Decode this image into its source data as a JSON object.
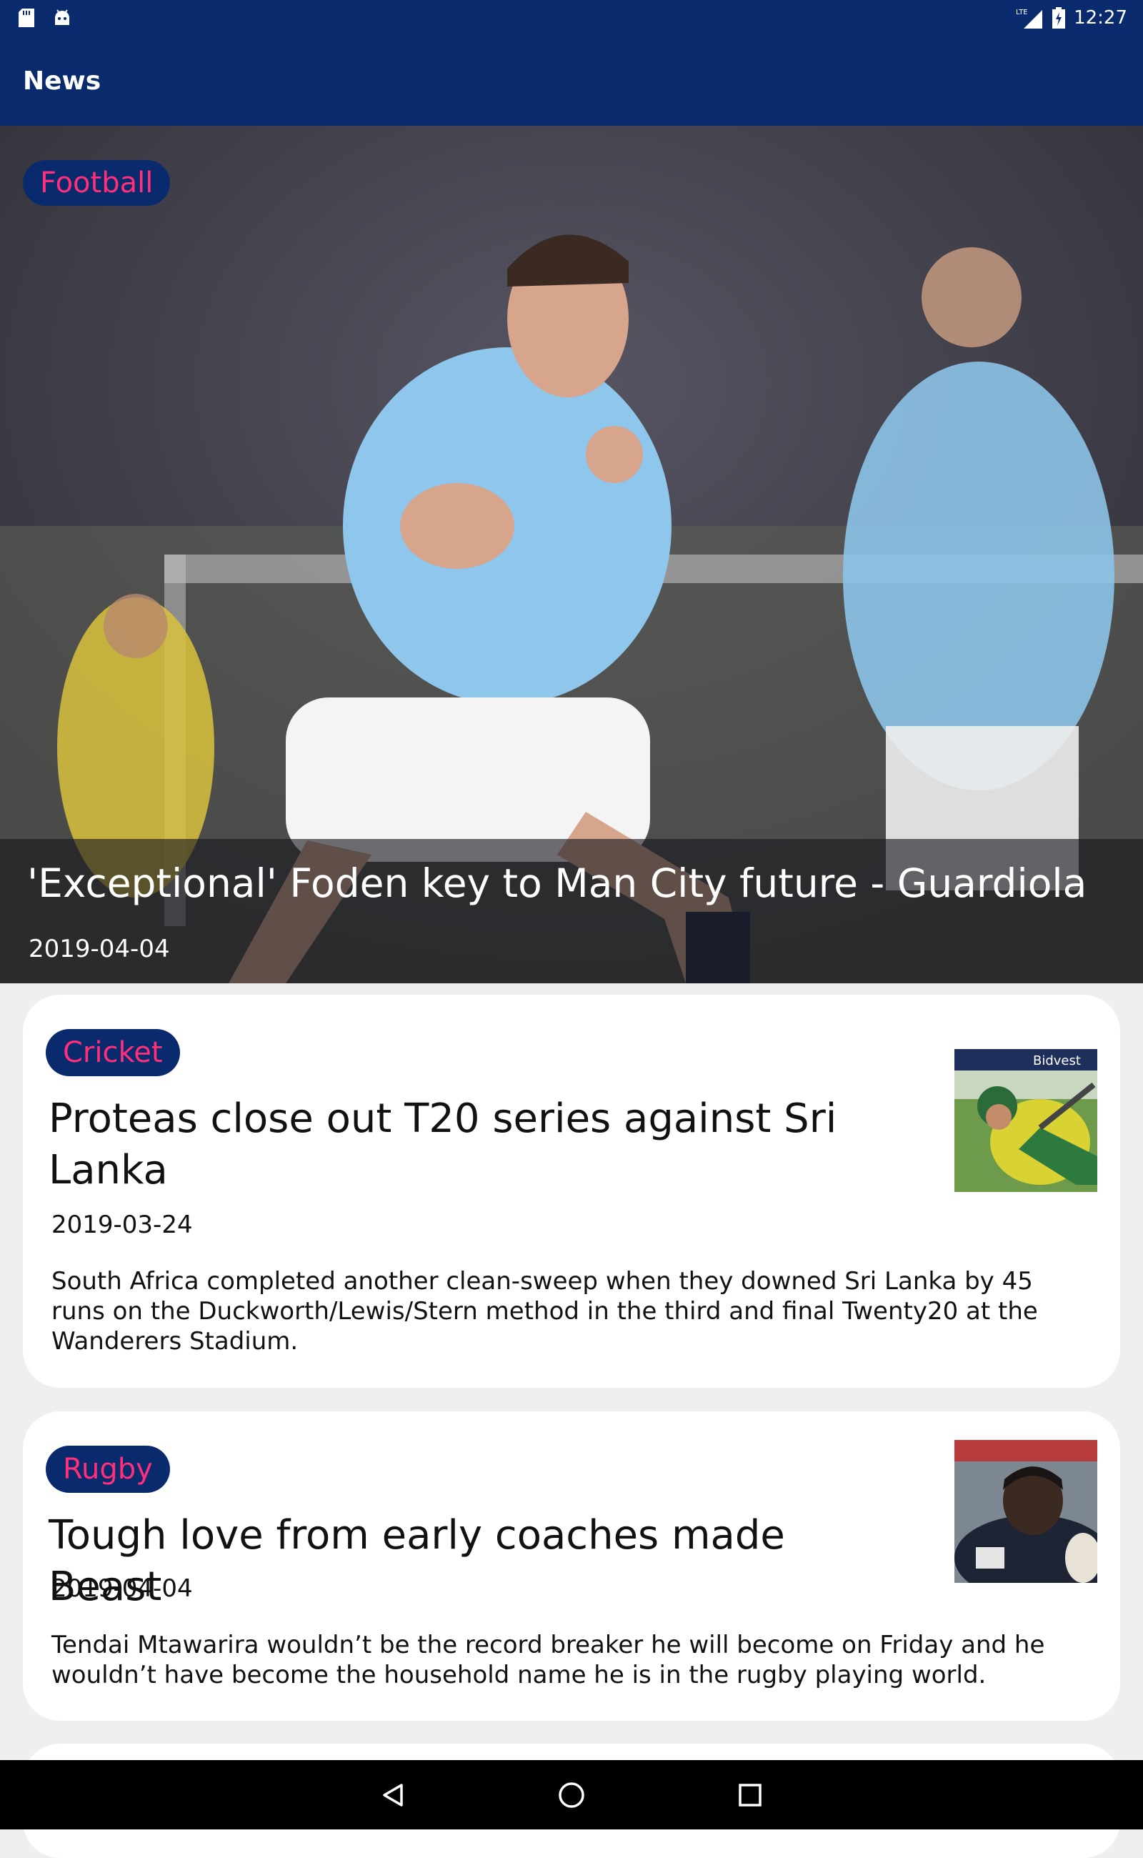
{
  "status_bar": {
    "time": "12:27",
    "network": "LTE",
    "icons": [
      "sd-card-icon",
      "android-debug-icon",
      "signal-icon",
      "battery-icon"
    ]
  },
  "app_bar": {
    "title": "News"
  },
  "featured": {
    "category": "Football",
    "title": "'Exceptional' Foden key to Man City future - Guardiola",
    "date": "2019-04-04"
  },
  "articles": [
    {
      "category": "Cricket",
      "title": "Proteas close out T20 series against Sri Lanka",
      "date": "2019-03-24",
      "description": "South Africa completed another clean-sweep when they downed Sri Lanka by 45 runs on the Duckworth/Lewis/Stern method in the third and final Twenty20 at the Wanderers Stadium.",
      "thumbnail_banner": "Bidvest"
    },
    {
      "category": "Rugby",
      "title": "Tough love from early coaches made Beast",
      "date": "2019-04-04",
      "description": "Tendai Mtawarira wouldn’t be the record breaker he will become on Friday and he wouldn’t have become the household name he is in the rugby playing world."
    }
  ],
  "colors": {
    "primary": "#0a2a6e",
    "category_text": "#ff2f7a",
    "card_background": "#ffffff",
    "page_background": "#efefef"
  },
  "nav_bar": {
    "icons": [
      "back-icon",
      "home-icon",
      "recents-icon"
    ]
  }
}
